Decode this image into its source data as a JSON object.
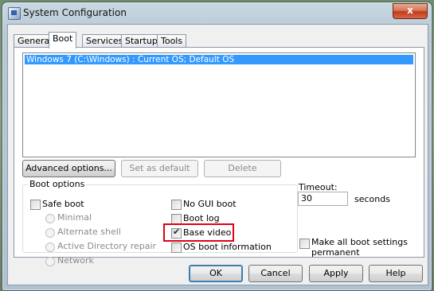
{
  "window": {
    "title": "System Configuration",
    "close_glyph": "x"
  },
  "tabs": [
    {
      "label": "General"
    },
    {
      "label": "Boot"
    },
    {
      "label": "Services"
    },
    {
      "label": "Startup"
    },
    {
      "label": "Tools"
    }
  ],
  "boot_list": {
    "items": [
      "Windows 7 (C:\\Windows) : Current OS; Default OS"
    ]
  },
  "list_buttons": {
    "advanced": "Advanced options...",
    "set_default": "Set as default",
    "delete": "Delete"
  },
  "boot_options": {
    "label": "Boot options",
    "safe_boot": {
      "label": "Safe boot",
      "checked": false
    },
    "radios": [
      "Minimal",
      "Alternate shell",
      "Active Directory repair",
      "Network"
    ],
    "no_gui_boot": {
      "label": "No GUI boot",
      "checked": false
    },
    "boot_log": {
      "label": "Boot log",
      "checked": false
    },
    "base_video": {
      "label": "Base video",
      "checked": true
    },
    "os_boot_info": {
      "label": "OS boot information",
      "checked": false
    }
  },
  "timeout": {
    "label": "Timeout:",
    "value": "30",
    "unit": "seconds"
  },
  "make_permanent": {
    "label_line1": "Make all boot settings",
    "label_line2": "permanent",
    "checked": false
  },
  "dialog_buttons": {
    "ok": "OK",
    "cancel": "Cancel",
    "apply": "Apply",
    "help": "Help"
  }
}
